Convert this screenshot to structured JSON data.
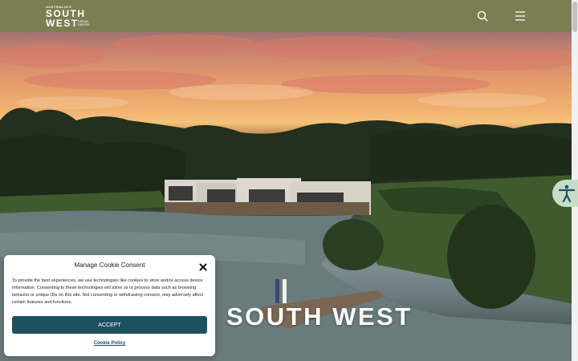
{
  "header": {
    "logo": {
      "prefix": "AUSTRALIA'S",
      "line1": "SOUTH",
      "line2": "WEST",
      "tagline": "DREAM DEEPER"
    },
    "search_icon": "search-icon",
    "menu_icon": "hamburger-menu-icon",
    "background_color": "#7c7d52"
  },
  "hero": {
    "title": "SOUTH WEST",
    "image": "sunset-lake-villas-aerial"
  },
  "accessibility": {
    "icon": "accessibility-person-icon",
    "color": "#c7dcc6"
  },
  "cookie_banner": {
    "title": "Manage Cookie Consent",
    "text": "To provide the best experiences, we use technologies like cookies to store and/or access device information. Consenting to these technologies will allow us to process data such as browsing behavior or unique IDs on this site. Not consenting or withdrawing consent, may adversely affect certain features and functions.",
    "accept_label": "ACCEPT",
    "policy_label": "Cookie Policy",
    "close_icon": "close-icon",
    "accent_color": "#1e5160"
  }
}
